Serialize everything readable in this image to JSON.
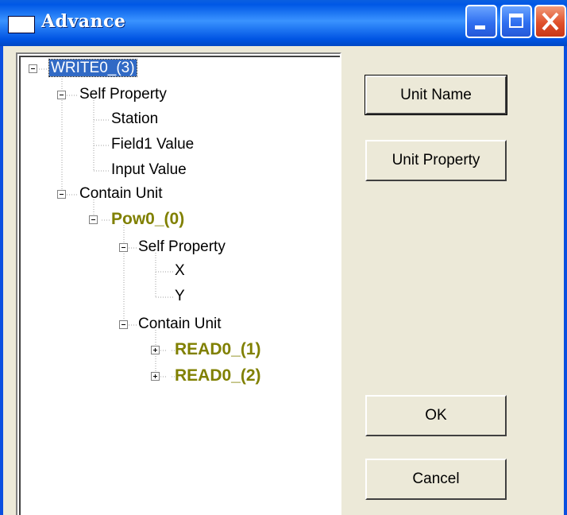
{
  "window": {
    "title": "Advance"
  },
  "colors": {
    "titlebar": "#0058e6",
    "selection": "#316ac5",
    "unit_text": "#808000",
    "face": "#ece9d8"
  },
  "tree": {
    "root": "WRITE0_(3)",
    "self_property": "Self Property",
    "station": "Station",
    "field1_value": "Field1 Value",
    "input_value": "Input Value",
    "contain_unit": "Contain Unit",
    "pow_unit": "Pow0_(0)",
    "pow_self_property": "Self Property",
    "x": "X",
    "y": "Y",
    "pow_contain_unit": "Contain Unit",
    "read1": "READ0_(1)",
    "read2": "READ0_(2)"
  },
  "buttons": {
    "unit_name": "Unit Name",
    "unit_property": "Unit Property",
    "ok": "OK",
    "cancel": "Cancel"
  }
}
